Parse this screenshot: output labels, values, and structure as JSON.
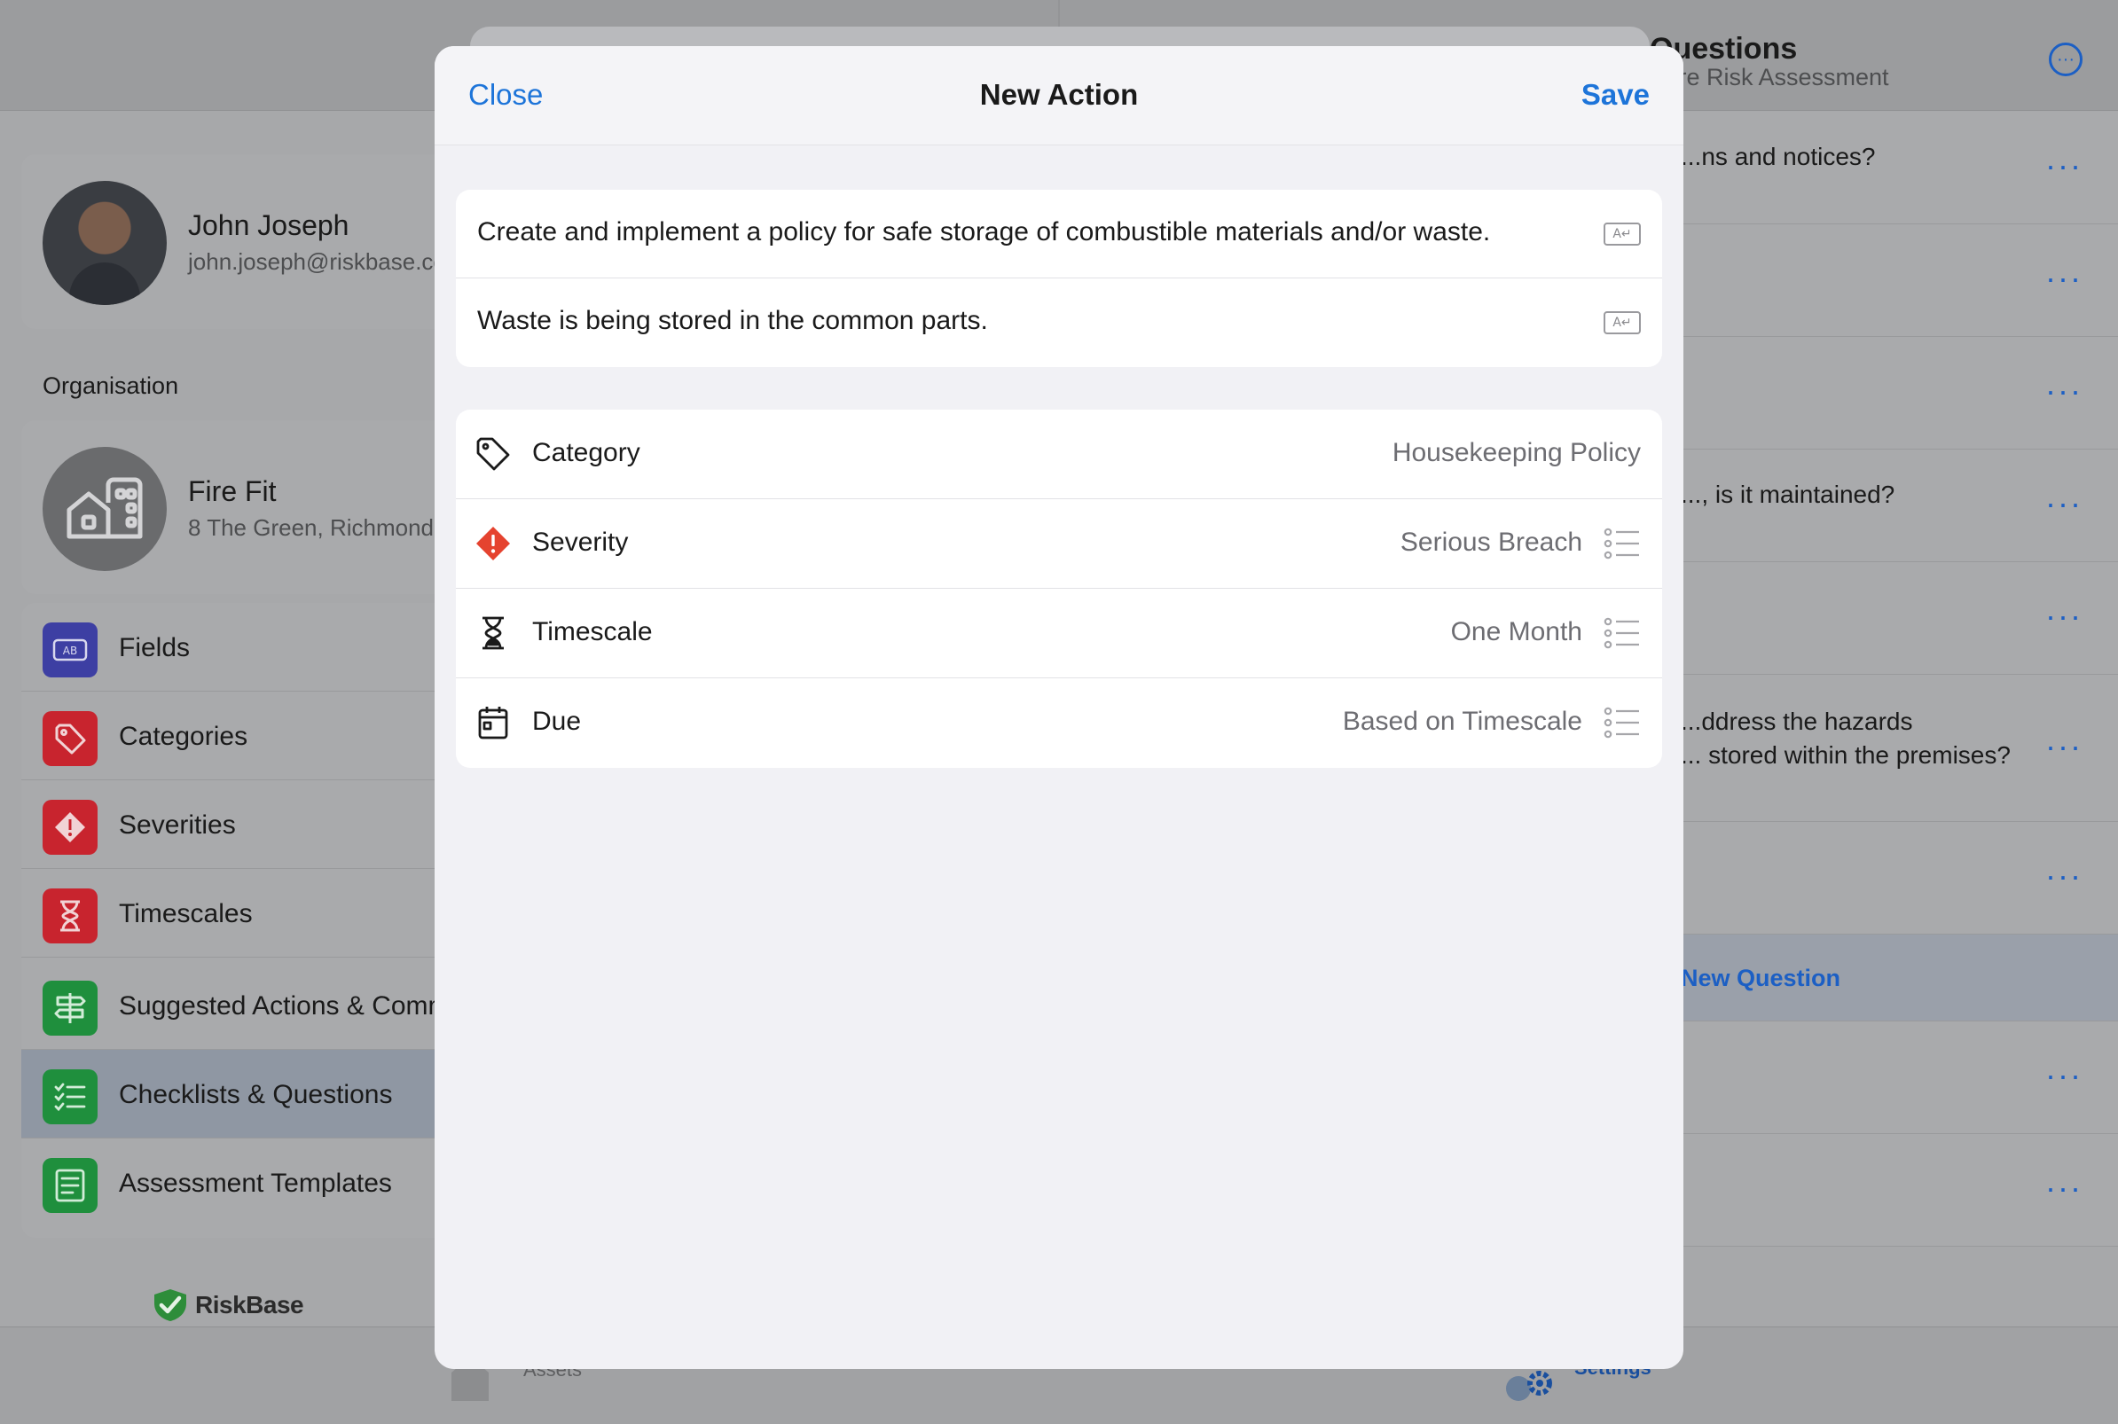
{
  "profile": {
    "name": "John Joseph",
    "email": "john.joseph@riskbase.com"
  },
  "sidebar": {
    "section_label": "Organisation",
    "org": {
      "name": "Fire Fit",
      "address": "8 The Green, Richmond"
    },
    "items": [
      {
        "label": "Fields",
        "icon": "fields-icon",
        "color": "#3d3fa3"
      },
      {
        "label": "Categories",
        "icon": "tag-icon",
        "color": "#d8232f"
      },
      {
        "label": "Severities",
        "icon": "severity-icon",
        "color": "#d8232f"
      },
      {
        "label": "Timescales",
        "icon": "hourglass-icon",
        "color": "#d8232f"
      },
      {
        "label": "Suggested Actions & Comments",
        "icon": "signpost-icon",
        "color": "#1e9a3f"
      },
      {
        "label": "Checklists & Questions",
        "icon": "checklist-icon",
        "color": "#1e9a3f"
      },
      {
        "label": "Assessment Templates",
        "icon": "template-icon",
        "color": "#1e9a3f"
      }
    ],
    "active_item": "Checklists & Questions",
    "brand": "RiskBase"
  },
  "tabbar": {
    "assets_label": "Assets",
    "settings_label": "Settings"
  },
  "right_panel": {
    "title": "Questions",
    "subtitle": "Fire Risk Assessment",
    "questions": [
      "...ns and notices?",
      "",
      "",
      "..., is it maintained?",
      "",
      "...ddress the hazards\n... stored within the premises?",
      ""
    ],
    "new_question_label": "New Question",
    "extra_rows": [
      "",
      ""
    ]
  },
  "modal": {
    "title": "New Action",
    "close_label": "Close",
    "save_label": "Save",
    "action_text": "Create and implement a policy for safe storage of combustible materials and/or waste.",
    "observation_text": "Waste is being stored in the common parts.",
    "fields": {
      "category": {
        "label": "Category",
        "value": "Housekeeping Policy"
      },
      "severity": {
        "label": "Severity",
        "value": "Serious Breach",
        "color": "#e5432f"
      },
      "timescale": {
        "label": "Timescale",
        "value": "One Month"
      },
      "due": {
        "label": "Due",
        "value": "Based on Timescale"
      }
    }
  },
  "colors": {
    "accent": "#1d74d9",
    "severity": "#e5432f"
  }
}
